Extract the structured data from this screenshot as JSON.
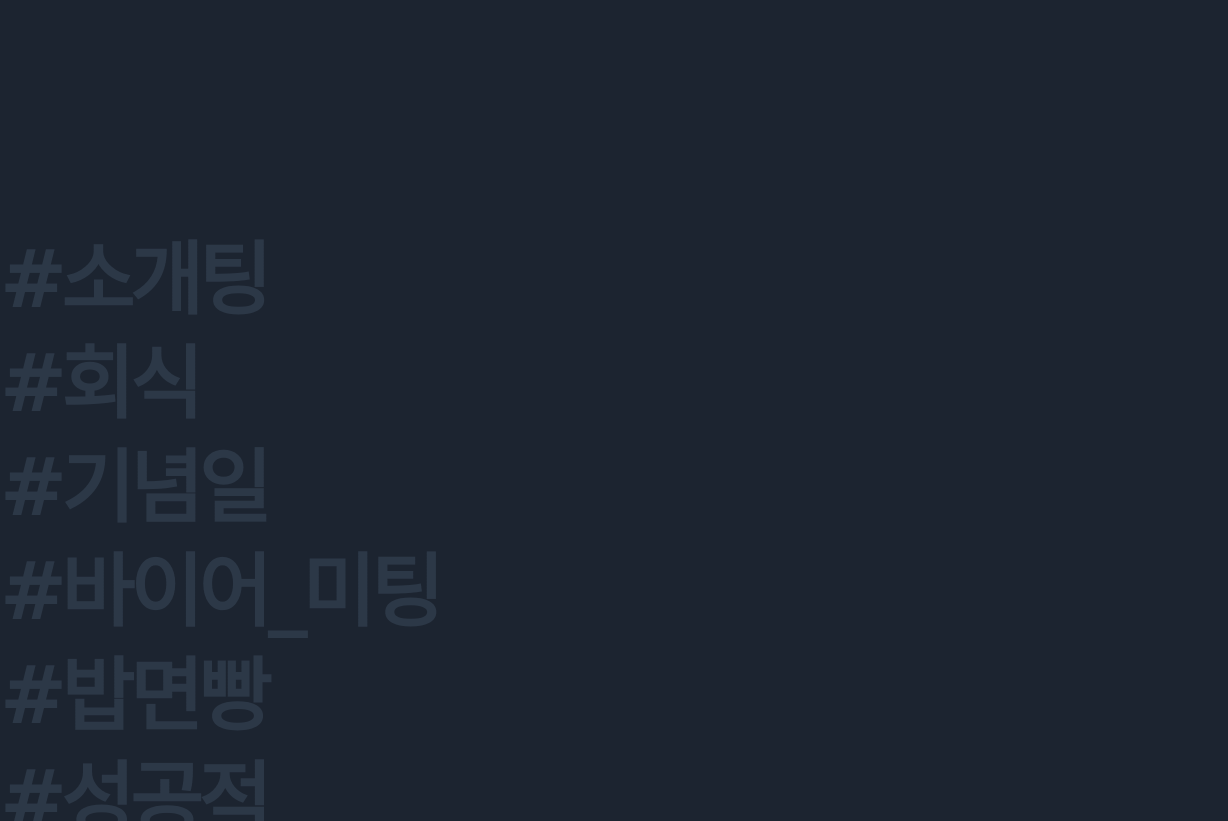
{
  "hashtags": [
    "#소개팅",
    "#회식",
    "#기념일",
    "#바이어_미팅",
    "#밥면빵",
    "#성공적"
  ]
}
